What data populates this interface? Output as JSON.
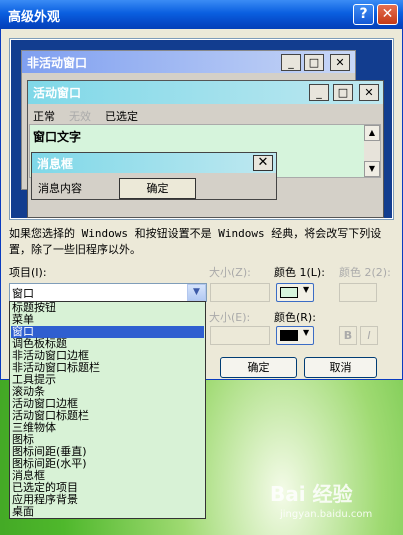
{
  "window": {
    "title": "高级外观",
    "help_icon": "?",
    "close_icon": "✕"
  },
  "preview": {
    "inactive_title": "非活动窗口",
    "active_title": "活动窗口",
    "menu": [
      "正常",
      "无效",
      "已选定"
    ],
    "window_text": "窗口文字",
    "msgbox_title": "消息框",
    "msgbox_content": "消息内容",
    "msgbox_ok": "确定"
  },
  "description": "如果您选择的 Windows 和按钮设置不是 Windows 经典，将会改写下列设置，除了一些旧程序以外。",
  "item": {
    "label": "项目(I):",
    "selected": "窗口",
    "options": [
      "标题按钮",
      "菜单",
      "窗口",
      "调色板标题",
      "非活动窗口边框",
      "非活动窗口标题栏",
      "工具提示",
      "滚动条",
      "活动窗口边框",
      "活动窗口标题栏",
      "三维物体",
      "图标",
      "图标间距(垂直)",
      "图标间距(水平)",
      "消息框",
      "已选定的项目",
      "应用程序背景",
      "桌面"
    ],
    "selected_index": 2
  },
  "size_label": "大小(Z):",
  "color1_label": "颜色 1(L):",
  "color2_label": "颜色 2(2):",
  "font_size_label": "大小(E):",
  "font_color_label": "颜色(R):",
  "bold_label": "B",
  "italic_label": "I",
  "buttons": {
    "ok": "确定",
    "cancel": "取消"
  },
  "colors": {
    "color1": "#d6f4dc",
    "font_color": "#000000"
  },
  "watermark": {
    "brand": "Bai 经验",
    "url": "jingyan.baidu.com"
  }
}
